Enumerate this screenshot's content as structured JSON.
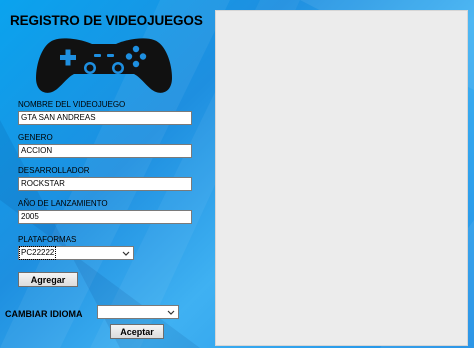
{
  "form": {
    "title": "REGISTRO DE VIDEOJUEGOS",
    "icon": "gamepad-icon",
    "fields": {
      "name": {
        "label": "NOMBRE DEL VIDEOJUEGO",
        "value": "GTA SAN ANDREAS"
      },
      "genre": {
        "label": "GENERO",
        "value": "ACCION"
      },
      "developer": {
        "label": "DESARROLLADOR",
        "value": "ROCKSTAR"
      },
      "year": {
        "label": "AÑO DE LANZAMIENTO",
        "value": "2005"
      },
      "platform": {
        "label": "PLATAFORMAS",
        "value": "PC22222"
      }
    },
    "add_button": "Agregar"
  },
  "language": {
    "label": "CAMBIAR IDIOMA",
    "value": "",
    "accept_button": "Aceptar"
  },
  "colors": {
    "background": "#1e8fe0",
    "panel": "#ececec",
    "gamepad": "#111111"
  }
}
